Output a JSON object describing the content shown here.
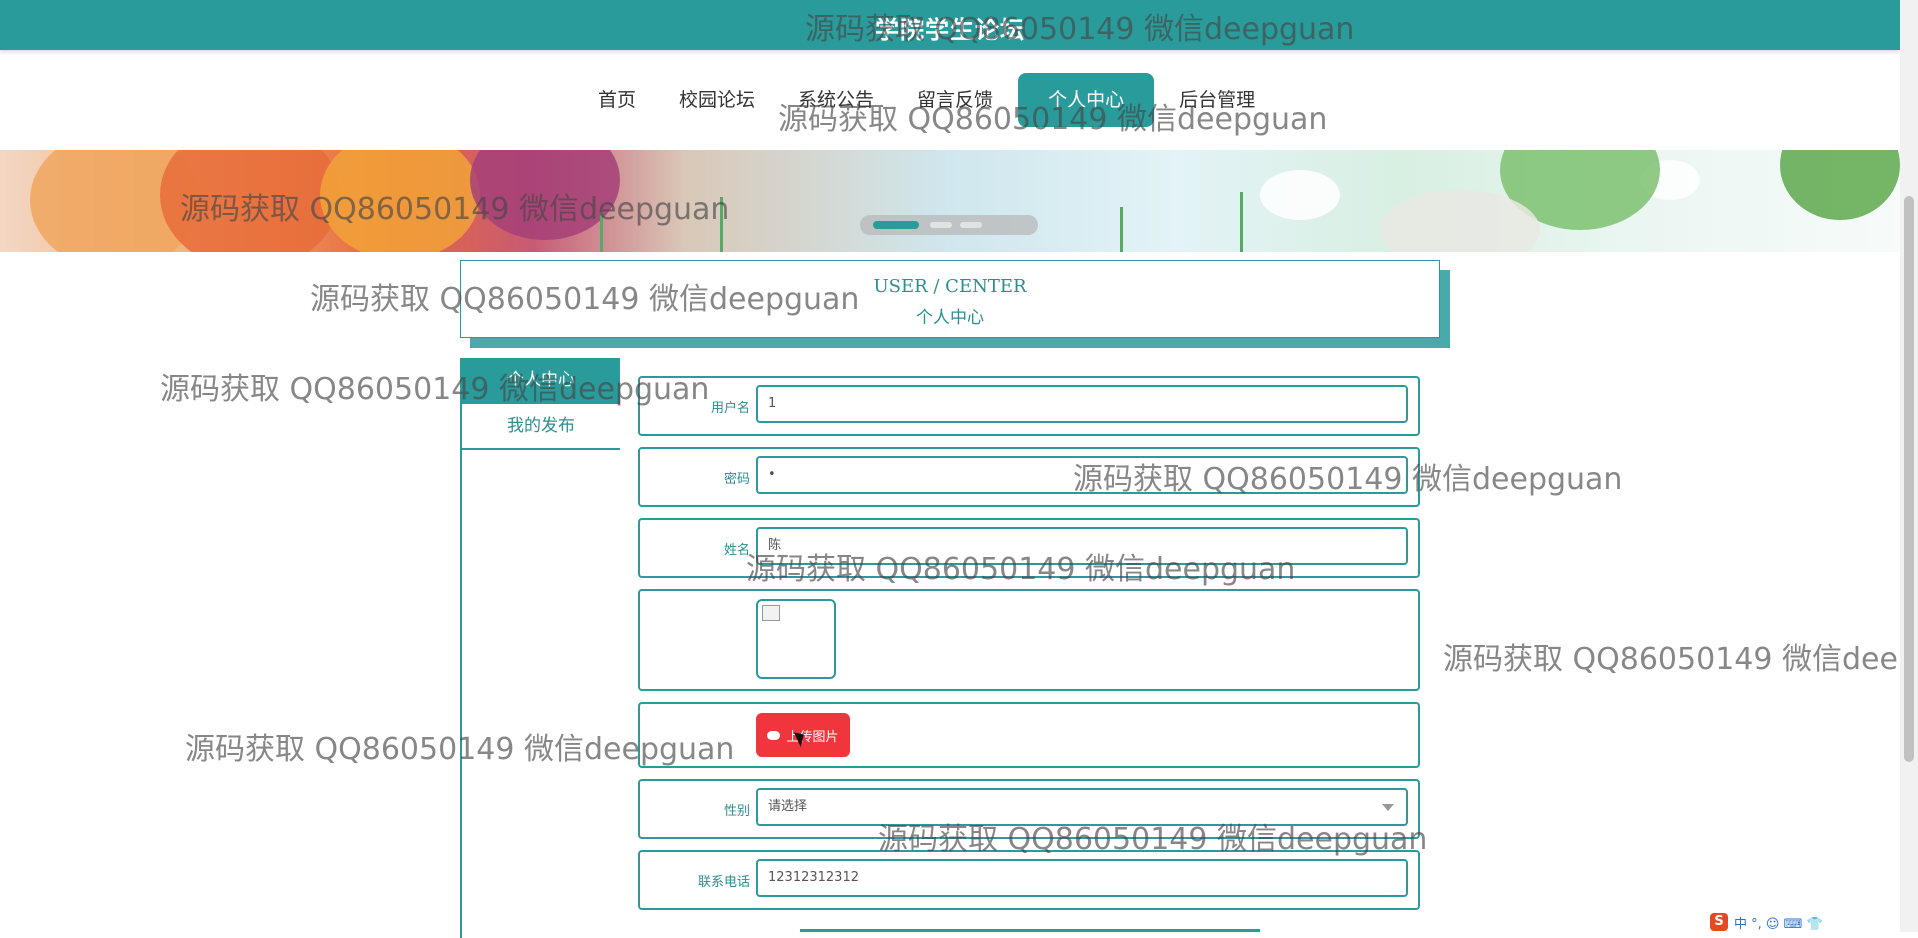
{
  "app": {
    "title": "学院学生论坛"
  },
  "nav": {
    "items": [
      {
        "label": "首页"
      },
      {
        "label": "校园论坛"
      },
      {
        "label": "系统公告"
      },
      {
        "label": "留言反馈"
      },
      {
        "label": "个人中心",
        "active": true
      },
      {
        "label": "后台管理"
      }
    ]
  },
  "banner": {
    "slides": 3,
    "active_slide": 1
  },
  "center": {
    "en": "USER / CENTER",
    "cn": "个人中心"
  },
  "sidebar": {
    "items": [
      {
        "label": "个人中心",
        "active": true
      },
      {
        "label": "我的发布"
      }
    ]
  },
  "form": {
    "username": {
      "label": "用户名",
      "value": "1"
    },
    "password": {
      "label": "密码",
      "value": "•"
    },
    "name": {
      "label": "姓名",
      "value": "陈"
    },
    "avatar": {
      "label": ""
    },
    "upload": {
      "label": "上传图片"
    },
    "gender": {
      "label": "性别",
      "value": "请选择"
    },
    "phone": {
      "label": "联系电话",
      "value": "12312312312"
    }
  },
  "watermark": {
    "text": "源码获取 QQ86050149 微信deepguan"
  },
  "ime": {
    "text": "中 °, ☺ ⌨ 👕"
  },
  "colors": {
    "primary": "#2a9b9b",
    "danger": "#f0353d"
  }
}
